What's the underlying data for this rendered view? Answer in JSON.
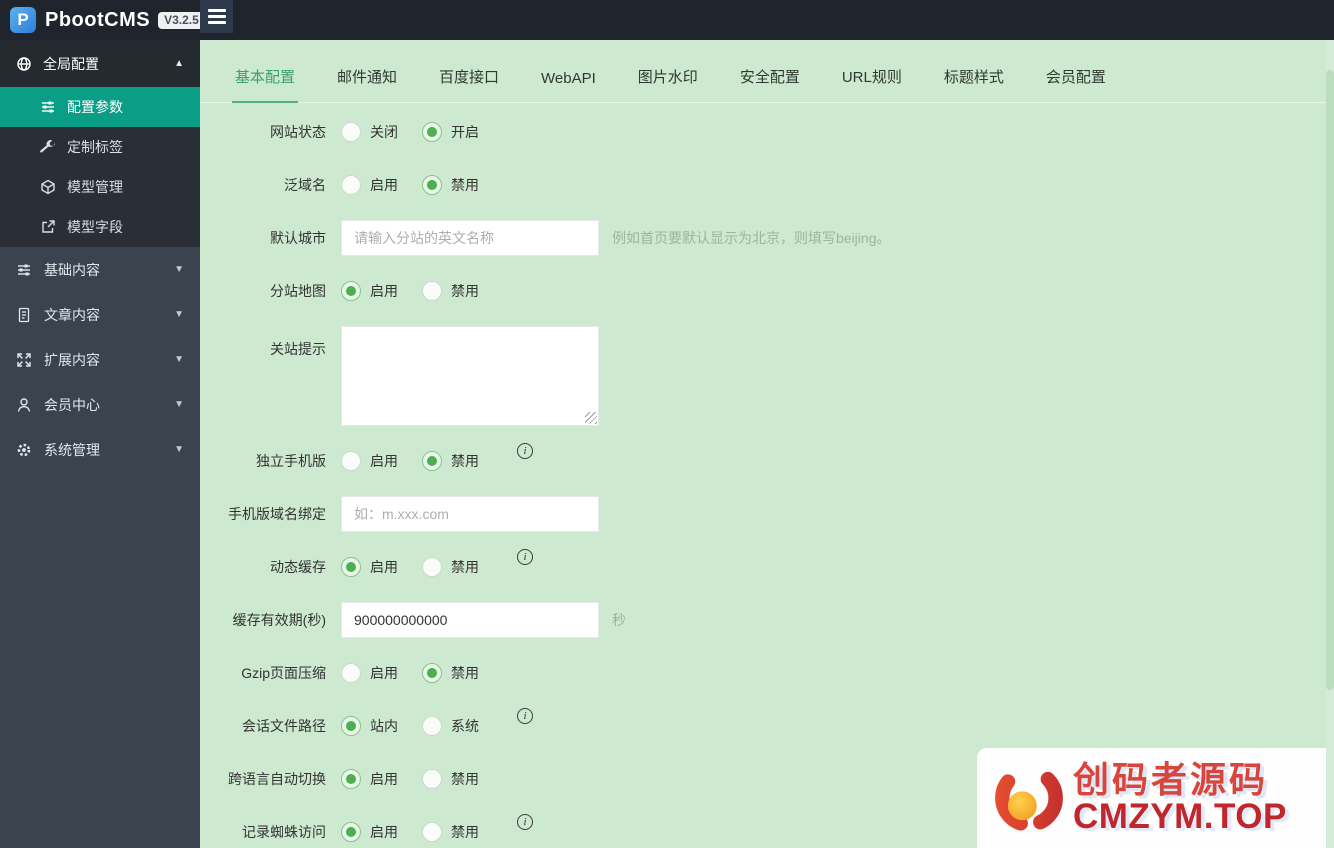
{
  "topbar": {
    "brand": "PbootCMS",
    "version": "V3.2.5"
  },
  "sidebar": {
    "parent": {
      "label": "全局配置",
      "icon": "globe-icon",
      "expanded": true
    },
    "submenu": [
      {
        "label": "配置参数",
        "icon": "sliders-icon",
        "active": true
      },
      {
        "label": "定制标签",
        "icon": "wrench-icon",
        "active": false
      },
      {
        "label": "模型管理",
        "icon": "cube-icon",
        "active": false
      },
      {
        "label": "模型字段",
        "icon": "external-link-icon",
        "active": false
      }
    ],
    "items": [
      {
        "label": "基础内容",
        "icon": "sliders-icon"
      },
      {
        "label": "文章内容",
        "icon": "file-text-icon"
      },
      {
        "label": "扩展内容",
        "icon": "expand-icon"
      },
      {
        "label": "会员中心",
        "icon": "user-icon"
      },
      {
        "label": "系统管理",
        "icon": "gear-icon"
      }
    ]
  },
  "tabs": [
    {
      "label": "基本配置",
      "active": true
    },
    {
      "label": "邮件通知",
      "active": false
    },
    {
      "label": "百度接口",
      "active": false
    },
    {
      "label": "WebAPI",
      "active": false
    },
    {
      "label": "图片水印",
      "active": false
    },
    {
      "label": "安全配置",
      "active": false
    },
    {
      "label": "URL规则",
      "active": false
    },
    {
      "label": "标题样式",
      "active": false
    },
    {
      "label": "会员配置",
      "active": false
    }
  ],
  "form": {
    "rows": [
      {
        "label": "网站状态",
        "type": "radio",
        "info": false,
        "options": [
          {
            "label": "关闭",
            "checked": false
          },
          {
            "label": "开启",
            "checked": true
          }
        ]
      },
      {
        "label": "泛域名",
        "type": "radio",
        "info": false,
        "options": [
          {
            "label": "启用",
            "checked": false
          },
          {
            "label": "禁用",
            "checked": true
          }
        ]
      },
      {
        "label": "默认城市",
        "type": "input",
        "value": "",
        "placeholder": "请输入分站的英文名称",
        "hint": "例如首页要默认显示为北京，则填写beijing。"
      },
      {
        "label": "分站地图",
        "type": "radio",
        "info": false,
        "options": [
          {
            "label": "启用",
            "checked": true
          },
          {
            "label": "禁用",
            "checked": false
          }
        ]
      },
      {
        "label": "关站提示",
        "type": "textarea",
        "value": ""
      },
      {
        "label": "独立手机版",
        "type": "radio",
        "info": true,
        "options": [
          {
            "label": "启用",
            "checked": false
          },
          {
            "label": "禁用",
            "checked": true
          }
        ]
      },
      {
        "label": "手机版域名绑定",
        "type": "input",
        "value": "",
        "placeholder": "如：m.xxx.com",
        "hint": ""
      },
      {
        "label": "动态缓存",
        "type": "radio",
        "info": true,
        "options": [
          {
            "label": "启用",
            "checked": true
          },
          {
            "label": "禁用",
            "checked": false
          }
        ]
      },
      {
        "label": "缓存有效期(秒)",
        "type": "input",
        "value": "900000000000",
        "placeholder": "",
        "hint": "秒"
      },
      {
        "label": "Gzip页面压缩",
        "type": "radio",
        "info": false,
        "options": [
          {
            "label": "启用",
            "checked": false
          },
          {
            "label": "禁用",
            "checked": true
          }
        ]
      },
      {
        "label": "会话文件路径",
        "type": "radio",
        "info": true,
        "options": [
          {
            "label": "站内",
            "checked": true
          },
          {
            "label": "系统",
            "checked": false
          }
        ]
      },
      {
        "label": "跨语言自动切换",
        "type": "radio",
        "info": false,
        "options": [
          {
            "label": "启用",
            "checked": true
          },
          {
            "label": "禁用",
            "checked": false
          }
        ]
      },
      {
        "label": "记录蜘蛛访问",
        "type": "radio",
        "info": true,
        "options": [
          {
            "label": "启用",
            "checked": true
          },
          {
            "label": "禁用",
            "checked": false
          }
        ]
      }
    ]
  },
  "watermark": {
    "line1": "创码者源码",
    "line2": "CMZYM.TOP"
  },
  "colors": {
    "topbar_bg": "#20242d",
    "sidebar_bg": "#3b434f",
    "accent_teal": "#0a9e86",
    "content_bg": "#cde9d0",
    "tab_active_green": "#3fa06a",
    "radio_checked_green": "#4caf50",
    "watermark_red": "#c0262c"
  }
}
